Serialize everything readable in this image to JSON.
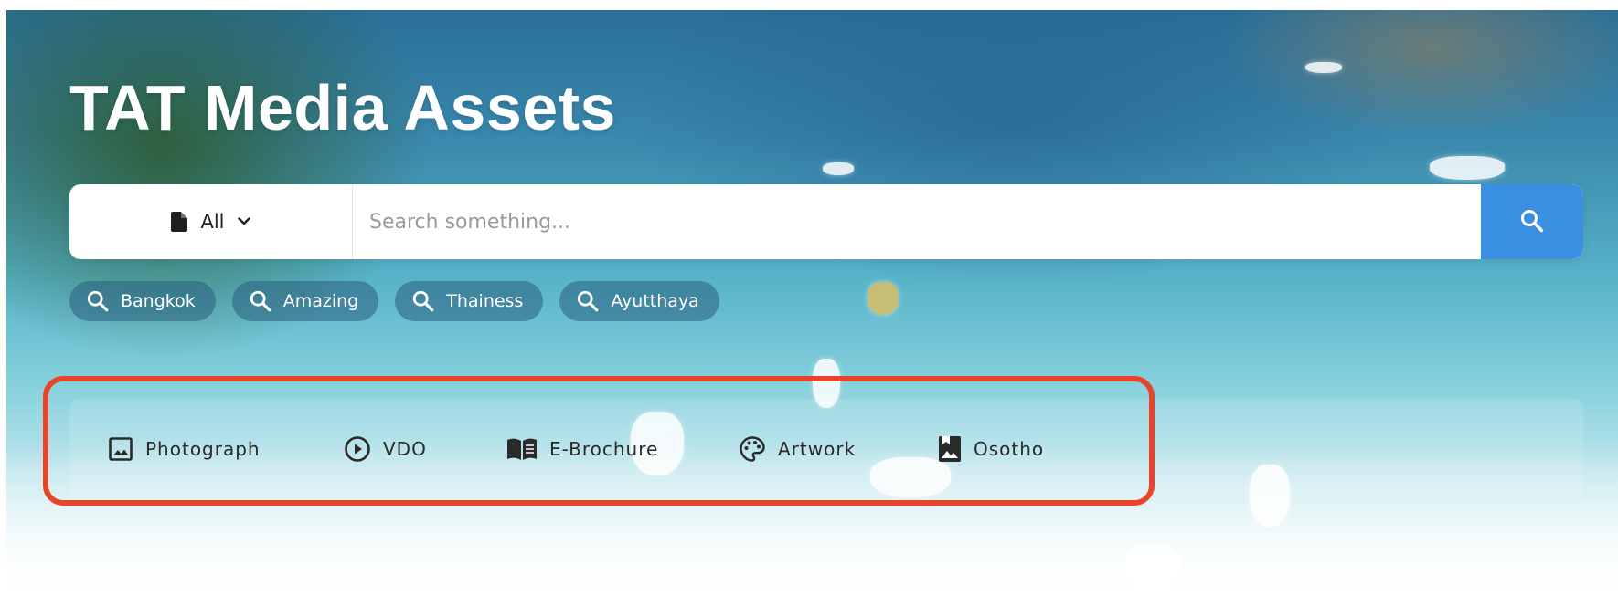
{
  "header": {
    "title": "TAT Media Assets"
  },
  "search": {
    "category": {
      "icon": "file-icon",
      "selected": "All",
      "caret": "chevron-down-icon"
    },
    "placeholder": "Search something...",
    "button_icon": "search-icon",
    "button_color": "#3b8fe0"
  },
  "quick_searches": [
    {
      "label": "Bangkok",
      "icon": "search-icon"
    },
    {
      "label": "Amazing",
      "icon": "search-icon"
    },
    {
      "label": "Thainess",
      "icon": "search-icon"
    },
    {
      "label": "Ayutthaya",
      "icon": "search-icon"
    }
  ],
  "media_types": [
    {
      "label": "Photograph",
      "icon": "image-icon"
    },
    {
      "label": "VDO",
      "icon": "play-circle-icon"
    },
    {
      "label": "E-Brochure",
      "icon": "book-icon"
    },
    {
      "label": "Artwork",
      "icon": "palette-icon"
    },
    {
      "label": "Osotho",
      "icon": "photo-bookmark-icon"
    }
  ],
  "colors": {
    "highlight": "#e84429",
    "chip_bg": "rgba(40,95,125,0.55)"
  }
}
